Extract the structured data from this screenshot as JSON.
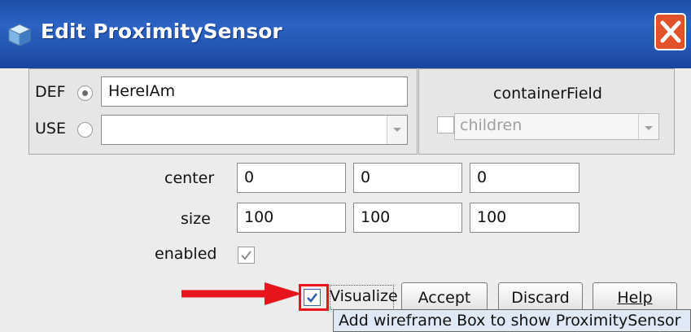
{
  "window": {
    "title": "Edit ProximitySensor"
  },
  "def": {
    "label": "DEF",
    "value": "HereIAm",
    "selected": true
  },
  "use": {
    "label": "USE",
    "value": "",
    "selected": false
  },
  "container_field": {
    "label": "containerField",
    "value": "children",
    "checked": false
  },
  "fields": [
    {
      "label": "center",
      "values": [
        "0",
        "0",
        "0"
      ]
    },
    {
      "label": "size",
      "values": [
        "100",
        "100",
        "100"
      ]
    }
  ],
  "enabled": {
    "label": "enabled",
    "checked": true
  },
  "visualize": {
    "label": "Visualize",
    "checked": true
  },
  "buttons": {
    "accept": "Accept",
    "discard": "Discard",
    "help": "Help"
  },
  "tooltip": {
    "text": "Add wireframe Box to show ProximitySensor"
  },
  "colors": {
    "annotation_red": "#e8141b",
    "title_blue": "#2456b2"
  }
}
